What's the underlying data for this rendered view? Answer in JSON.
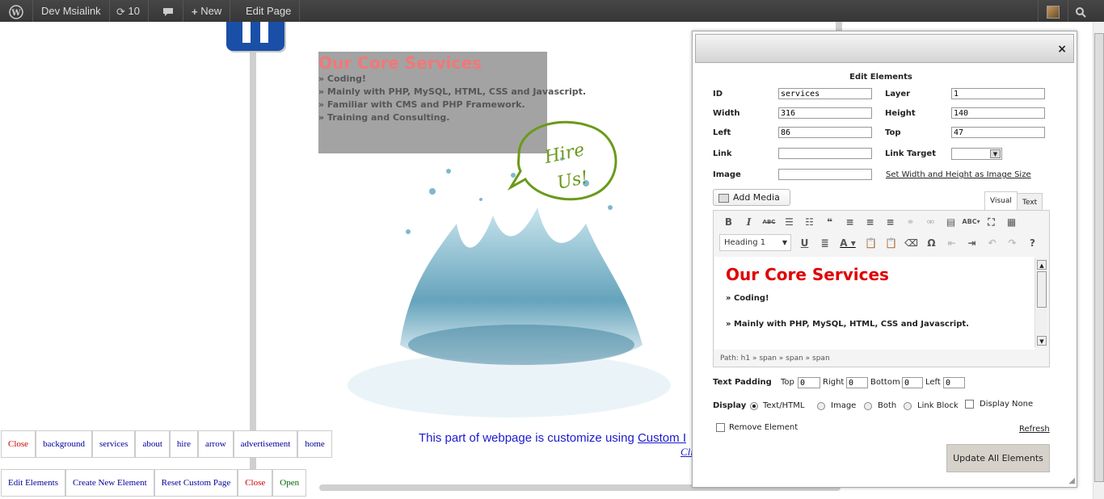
{
  "adminbar": {
    "site_name": "Dev Msialink",
    "updates_count": "10",
    "new_label": "New",
    "edit_page_label": "Edit Page"
  },
  "page": {
    "services_title": "Our Core Services",
    "services_items": [
      "» Coding!",
      "» Mainly with PHP, MySQL, HTML, CSS and Javascript.",
      "» Familiar with CMS and PHP Framework.",
      "» Training and Consulting."
    ],
    "hire_line1": "Hire",
    "hire_line2": "Us!",
    "customize_text": "This part of webpage is customize using ",
    "customize_link": "Custom I",
    "click_link": "Cli"
  },
  "element_buttons": [
    "Close",
    "background",
    "services",
    "about",
    "hire",
    "arrow",
    "advertisement",
    "home"
  ],
  "action_buttons": [
    "Edit Elements",
    "Create New Element",
    "Reset Custom Page",
    "Close",
    "Open"
  ],
  "dialog": {
    "close_glyph": "×",
    "heading": "Edit Elements",
    "fields": {
      "id_label": "ID",
      "id_value": "services",
      "layer_label": "Layer",
      "layer_value": "1",
      "width_label": "Width",
      "width_value": "316",
      "height_label": "Height",
      "height_value": "140",
      "left_label": "Left",
      "left_value": "86",
      "top_label": "Top",
      "top_value": "47",
      "link_label": "Link",
      "link_value": "",
      "link_target_label": "Link Target",
      "image_label": "Image",
      "image_value": "",
      "set_size_link": "Set Width and Height as Image Size"
    },
    "add_media": "Add Media",
    "tab_visual": "Visual",
    "tab_text": "Text",
    "format_select": "Heading 1",
    "editor_content": {
      "heading": "Our Core Services",
      "lines": [
        "» Coding!",
        "» Mainly with PHP, MySQL, HTML, CSS and Javascript."
      ]
    },
    "path_text": "Path: h1 » span » span » span",
    "padding": {
      "label": "Text Padding",
      "top_label": "Top",
      "top_value": "0",
      "right_label": "Right",
      "right_value": "0",
      "bottom_label": "Bottom",
      "bottom_value": "0",
      "left_label": "Left",
      "left_value": "0"
    },
    "display": {
      "label": "Display",
      "options": [
        "Text/HTML",
        "Image",
        "Both",
        "Link Block"
      ],
      "selected": "Text/HTML",
      "display_none": "Display None"
    },
    "remove_element": "Remove Element",
    "refresh": "Refresh",
    "update_button": "Update All Elements"
  },
  "colors": {
    "services_title": "#f06a6a",
    "editor_heading": "#e00000",
    "link_blue": "#1a1ad0",
    "hire_green": "#6a9a1a"
  }
}
